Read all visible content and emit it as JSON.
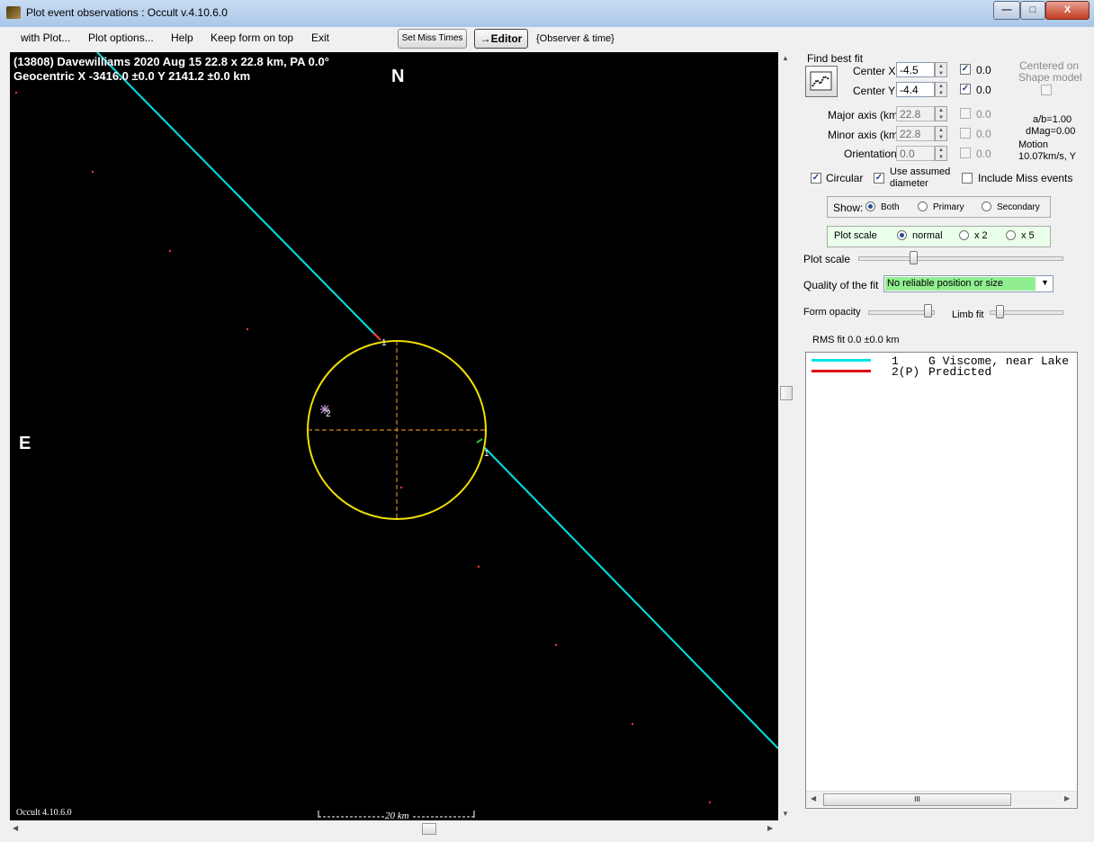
{
  "window": {
    "title": "Plot event observations : Occult v.4.10.6.0",
    "minimize": "—",
    "maximize": "□",
    "close": "X"
  },
  "menu": {
    "items": [
      "with Plot...",
      "Plot options...",
      "Help",
      "Keep form on top",
      "Exit"
    ],
    "set_miss_times": "Set Miss Times",
    "editor": "→Editor",
    "observer_time": "{Observer & time}"
  },
  "plot": {
    "header_line1": "(13808) Davewilliams  2020 Aug 15   22.8 x 22.8 km,  PA 0.0°",
    "header_line2": "Geocentric  X  -3416.0 ±0.0   Y 2141.2 ±0.0 km",
    "north": "N",
    "east": "E",
    "footer_version": "Occult 4.10.6.0",
    "scale_label": "20 km",
    "chord_label_1a": "1",
    "chord_label_1b": "1",
    "chord_label_2": "2",
    "colors": {
      "chord": "#00e5e5",
      "ellipse": "#f0e000",
      "axes": "#d08a1a",
      "dots": "#ff3030"
    }
  },
  "panel": {
    "find_best_fit": "Find best fit",
    "center_x_label": "Center X",
    "center_x_value": "-4.5",
    "center_x_err": "0.0",
    "center_y_label": "Center Y",
    "center_y_value": "-4.4",
    "center_y_err": "0.0",
    "centered_on": "Centered on",
    "shape_model": "Shape model",
    "major_label": "Major axis (km)",
    "major_value": "22.8",
    "major_err": "0.0",
    "minor_label": "Minor axis (km)",
    "minor_value": "22.8",
    "minor_err": "0.0",
    "orient_label": "Orientation",
    "orient_value": "0.0",
    "orient_err": "0.0",
    "ab": "a/b=1.00",
    "dmag": "dMag=0.00",
    "motion": "Motion",
    "motion_value": "10.07km/s, Y",
    "circular": "Circular",
    "use_assumed_1": "Use assumed",
    "use_assumed_2": "diameter",
    "include_miss": "Include Miss events",
    "show_label": "Show:",
    "show_both": "Both",
    "show_primary": "Primary",
    "show_secondary": "Secondary",
    "plot_scale_group": "Plot scale",
    "scale_normal": "normal",
    "scale_x2": "x 2",
    "scale_x5": "x 5",
    "plot_scale_slider": "Plot scale",
    "quality_label": "Quality of the fit",
    "quality_value": "No reliable position or size",
    "form_opacity": "Form opacity",
    "limb_fit": "Limb fit",
    "rms_fit": "RMS fit  0.0 ±0.0 km"
  },
  "legend": [
    {
      "num": "1",
      "name": "G Viscome, near Lake",
      "color": "#00e5e5"
    },
    {
      "num": "2(P)",
      "name": "Predicted",
      "color": "#e00000"
    }
  ],
  "scroll": {
    "hthumb": "III"
  }
}
